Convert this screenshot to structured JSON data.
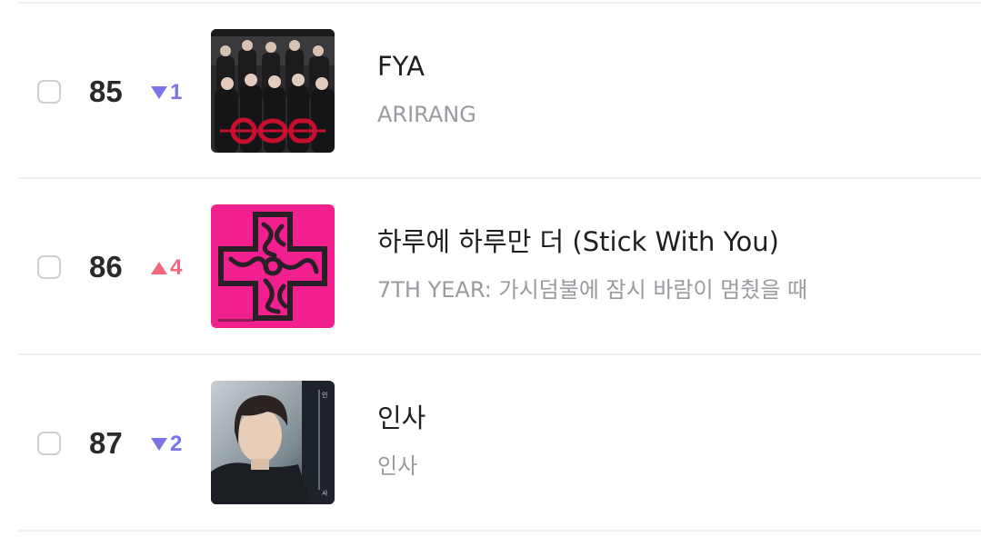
{
  "chart": {
    "entries": [
      {
        "rank": "85",
        "change_direction": "down",
        "change_value": "1",
        "change_color": "#7b73e6",
        "title": "FYA",
        "album": "ARIRANG",
        "cover_icon": "album-cover-group-photo"
      },
      {
        "rank": "86",
        "change_direction": "up",
        "change_value": "4",
        "change_color": "#f2667e",
        "title": "하루에 하루만 더 (Stick With You)",
        "album": "7TH YEAR: 가시덤불에 잠시 바람이 멈췄을 때",
        "cover_icon": "album-cover-pink-cross"
      },
      {
        "rank": "87",
        "change_direction": "down",
        "change_value": "2",
        "change_color": "#7b73e6",
        "title": "인사",
        "album": "인사",
        "cover_icon": "album-cover-portrait"
      }
    ]
  }
}
